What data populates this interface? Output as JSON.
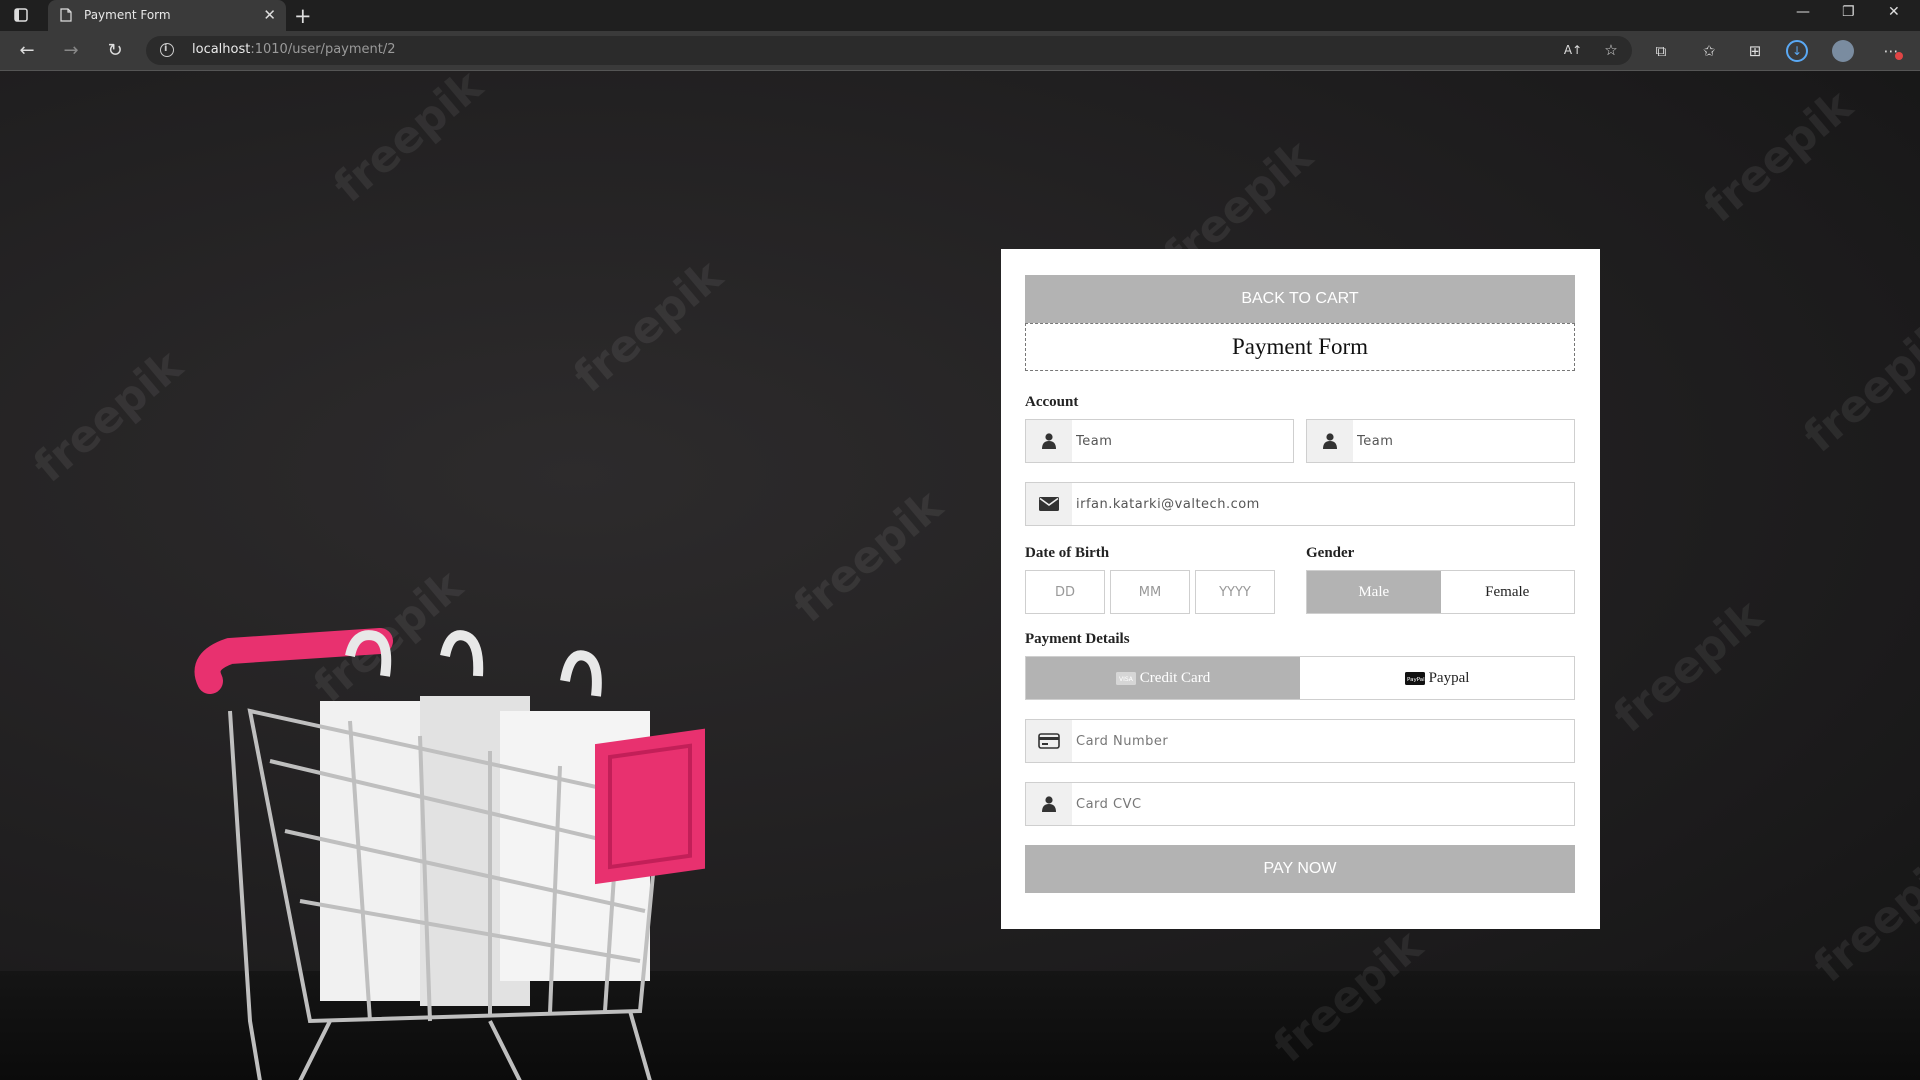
{
  "browser": {
    "tab_title": "Payment Form",
    "url_host": "localhost",
    "url_path": ":1010/user/payment/2"
  },
  "page": {
    "watermark_text": "freepik"
  },
  "form": {
    "back_label": "BACK TO CART",
    "title": "Payment Form",
    "account_label": "Account",
    "first_name": {
      "value": "Team"
    },
    "last_name": {
      "value": "Team"
    },
    "email": {
      "value": "irfan.katarki@valtech.com"
    },
    "dob_label": "Date of Birth",
    "dob": {
      "dd_placeholder": "DD",
      "mm_placeholder": "MM",
      "yyyy_placeholder": "YYYY"
    },
    "gender_label": "Gender",
    "gender_options": [
      "Male",
      "Female"
    ],
    "gender_selected": "Male",
    "payment_label": "Payment Details",
    "payment_options": [
      "Credit Card",
      "Paypal"
    ],
    "payment_selected": "Credit Card",
    "card_number_placeholder": "Card Number",
    "card_cvc_placeholder": "Card CVC",
    "pay_label": "PAY NOW"
  },
  "colors": {
    "button_bg": "#b3b3b3",
    "card_bg": "#ffffff",
    "cart_accent": "#e8316f"
  }
}
